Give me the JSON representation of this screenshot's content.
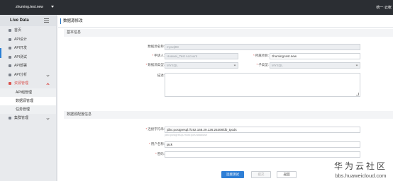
{
  "topbar": {
    "project": "zhuming.test.new",
    "right_text": "统一·云帐"
  },
  "sidebar": {
    "brand": "Live Data",
    "items": [
      {
        "label": "首页"
      },
      {
        "label": "API设计"
      },
      {
        "label": "API开发"
      },
      {
        "label": "API测试"
      },
      {
        "label": "API部署"
      },
      {
        "label": "API分析"
      },
      {
        "label": "资源管理"
      }
    ],
    "subitems": [
      {
        "label": "API组管理"
      },
      {
        "label": "数据源管理"
      },
      {
        "label": "任务管理"
      }
    ],
    "bottom_item": {
      "label": "集群管理"
    }
  },
  "page": {
    "title": "数据源修改"
  },
  "basic": {
    "section_title": "基本信息",
    "name_label": "数据源名称:",
    "name_value": "mysql03",
    "owner_label": "申请人:",
    "owner_value": "Huawei_Test Account",
    "project_label": "所属项目:",
    "project_value": "zhuming.test.new",
    "type_label": "数据源类型:",
    "type_value": "MYSQL",
    "subtype_label": "子类型:",
    "subtype_value": "MYSQL",
    "desc_label": "描述:",
    "desc_value": ""
  },
  "config": {
    "section_title": "数据源配置信息",
    "conn_label": "连接字符串:",
    "conn_value": "jdbc:postgresql://192.168.29.126:25308/db_tpcds",
    "conn_hint": "jdbc:postgresql://host:port/database",
    "user_label": "用户名称:",
    "user_value": "jack",
    "pwd_label": "密码:",
    "pwd_value": ""
  },
  "buttons": {
    "test": "连接测试",
    "submit": "提交",
    "cancel": "返回"
  },
  "watermark": {
    "line1": "华为云社区",
    "line2": "bbs.huaweicloud.com"
  },
  "colors": {
    "accent": "#2f7fd6",
    "required": "#d9534f",
    "topbar": "#2b2e33"
  }
}
